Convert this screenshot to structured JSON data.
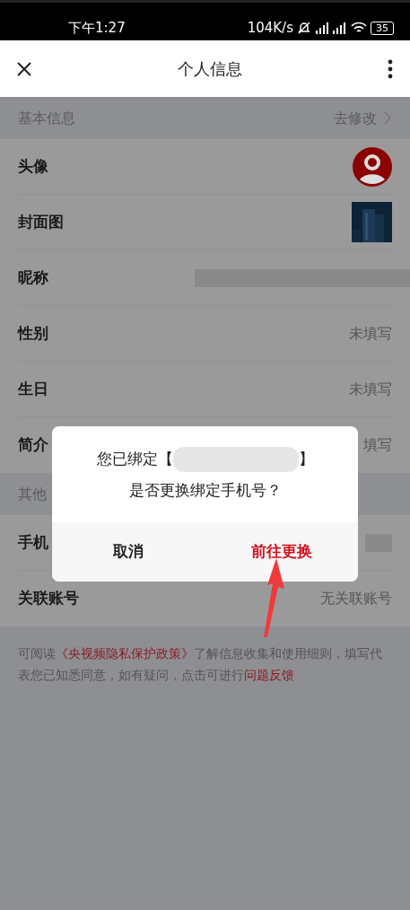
{
  "status_bar": {
    "time": "下午1:27",
    "speed": "104K/s",
    "battery": "35"
  },
  "header": {
    "title": "个人信息"
  },
  "sections": [
    {
      "title": "基本信息",
      "action": "去修改",
      "rows": [
        {
          "label": "头像",
          "kind": "avatar"
        },
        {
          "label": "封面图",
          "kind": "picture"
        },
        {
          "label": "昵称",
          "kind": "redacted"
        },
        {
          "label": "性别",
          "kind": "text",
          "value": "未填写"
        },
        {
          "label": "生日",
          "kind": "text",
          "value": "未填写"
        },
        {
          "label": "简介",
          "kind": "text",
          "value": "填写"
        }
      ]
    },
    {
      "title": "其他",
      "rows": [
        {
          "label": "手机",
          "kind": "redacted_short"
        },
        {
          "label": "关联账号",
          "kind": "text",
          "value": "无关联账号"
        }
      ]
    }
  ],
  "notice": [
    {
      "kind": "plain",
      "text": "可阅读"
    },
    {
      "kind": "link",
      "text": "《央视频隐私保护政策》"
    },
    {
      "kind": "plain",
      "text": "了解信息收集和使用细则，填写代表您已知悉同意，如有疑问，点击可进行"
    },
    {
      "kind": "link",
      "text": "问题反馈"
    }
  ],
  "dialog": {
    "message_prefix": "您已绑定【",
    "message_suffix": "】",
    "question": "是否更换绑定手机号？",
    "buttons": [
      {
        "label": "取消",
        "kind": "cancel"
      },
      {
        "label": "前往更换",
        "kind": "confirm"
      }
    ]
  }
}
